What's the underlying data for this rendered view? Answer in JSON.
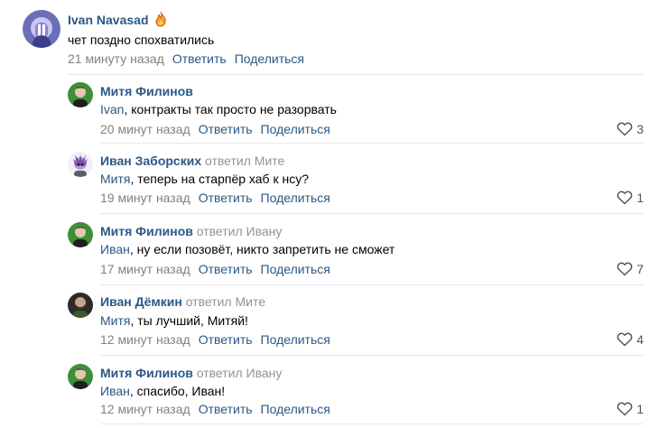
{
  "comment": {
    "author": "Ivan Navasad",
    "text": "чет поздно спохватились",
    "time": "21 минуту назад",
    "reply_label": "Ответить",
    "share_label": "Поделиться"
  },
  "replies": [
    {
      "author": "Митя Филинов",
      "reply_to": "",
      "mention": "Ivan",
      "text": ", контракты так просто не разорвать",
      "time": "20 минут назад",
      "reply_label": "Ответить",
      "share_label": "Поделиться",
      "likes": "3"
    },
    {
      "author": "Иван Заборских",
      "reply_to": "ответил Мите",
      "mention": "Митя",
      "text": ", теперь на старпёр хаб к нсу?",
      "time": "19 минут назад",
      "reply_label": "Ответить",
      "share_label": "Поделиться",
      "likes": "1"
    },
    {
      "author": "Митя Филинов",
      "reply_to": "ответил Ивану",
      "mention": "Иван",
      "text": ", ну если позовёт, никто запретить не сможет",
      "time": "17 минут назад",
      "reply_label": "Ответить",
      "share_label": "Поделиться",
      "likes": "7"
    },
    {
      "author": "Иван Дёмкин",
      "reply_to": "ответил Мите",
      "mention": "Митя",
      "text": ", ты лучший, Митяй!",
      "time": "12 минут назад",
      "reply_label": "Ответить",
      "share_label": "Поделиться",
      "likes": "4"
    },
    {
      "author": "Митя Филинов",
      "reply_to": "ответил Ивану",
      "mention": "Иван",
      "text": ", спасибо, Иван!",
      "time": "12 минут назад",
      "reply_label": "Ответить",
      "share_label": "Поделиться",
      "likes": "1"
    }
  ],
  "colors": {
    "link": "#2a5885",
    "meta": "#828282",
    "divider": "#e7e8ec"
  },
  "icons": {
    "like": "heart-outline-icon",
    "badge": "fire-icon"
  }
}
